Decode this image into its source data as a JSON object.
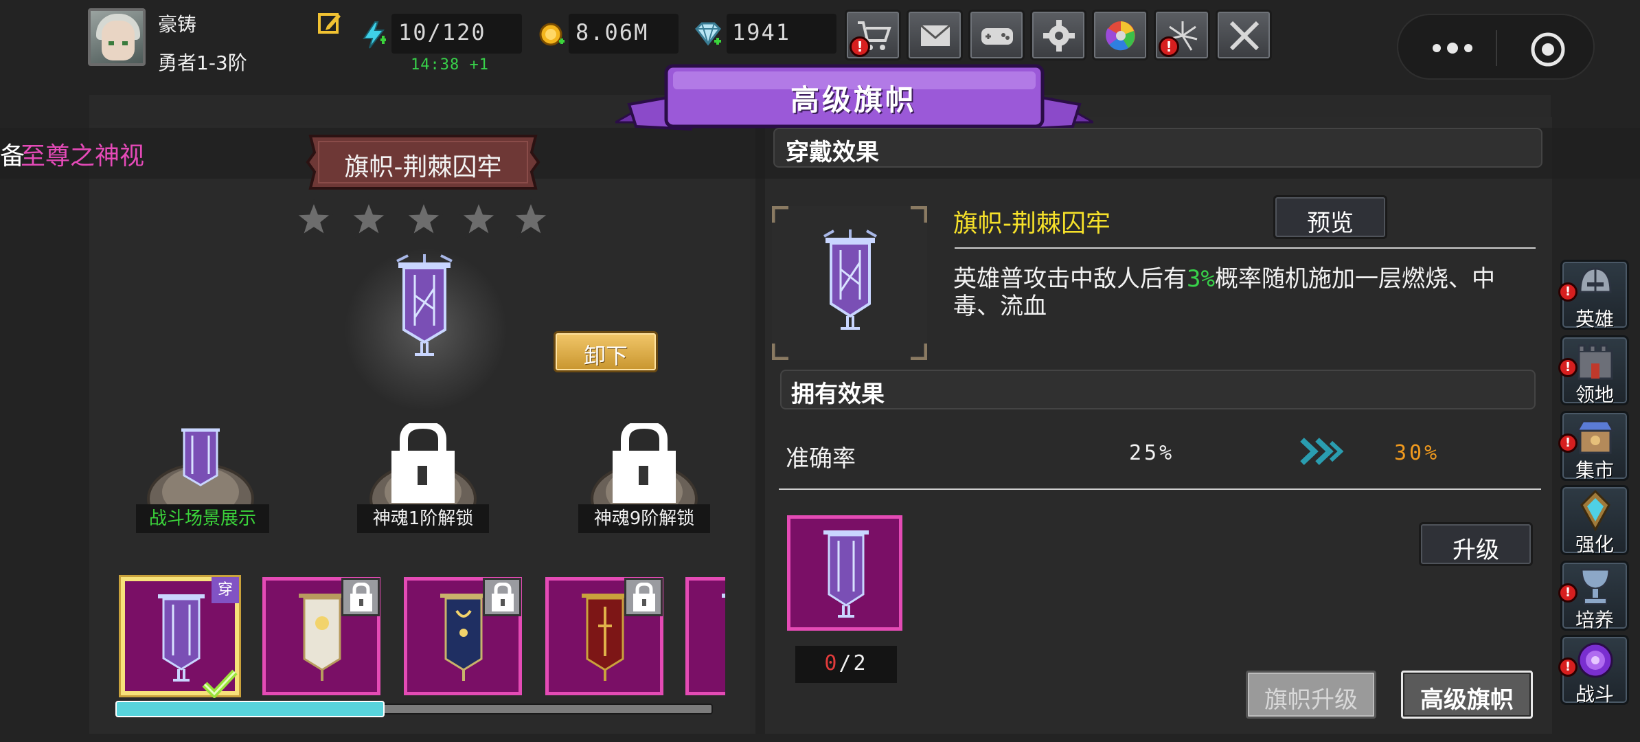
{
  "player": {
    "name": "豪铸",
    "rank": "勇者1-3阶",
    "avatar_icon": "hero-avatar-icon"
  },
  "resources": {
    "energy": "10/120",
    "energy_timer": "14:38 +1",
    "gold": "8.06M",
    "gems": "1941"
  },
  "top_buttons": [
    {
      "name": "shop-button",
      "icon": "cart-icon",
      "alert": true
    },
    {
      "name": "mail-button",
      "icon": "envelope-icon",
      "alert": false
    },
    {
      "name": "gamepad-button",
      "icon": "gamepad-icon",
      "alert": false
    },
    {
      "name": "settings-button",
      "icon": "gear-icon",
      "alert": false
    },
    {
      "name": "wheel-button",
      "icon": "color-wheel-icon",
      "alert": false
    },
    {
      "name": "fireworks-button",
      "icon": "fireworks-icon",
      "alert": true
    },
    {
      "name": "battle-button",
      "icon": "crossed-swords-icon",
      "alert": false
    }
  ],
  "alert_mark": "!",
  "marquee": {
    "prefix": "备",
    "item": "至尊之神视"
  },
  "page_title": "高级旗帜",
  "flag": {
    "name": "旗帜-荆棘囚牢",
    "stars": 5,
    "unequip_label": "卸下"
  },
  "pedestals": [
    {
      "label": "战斗场景展示",
      "locked": false,
      "color": "#3bd43b"
    },
    {
      "label": "神魂1阶解锁",
      "locked": true,
      "color": "#f2f2f2"
    },
    {
      "label": "神魂9阶解锁",
      "locked": true,
      "color": "#f2f2f2"
    }
  ],
  "cards": [
    {
      "name": "card-thorn-prison",
      "selected": true,
      "tag": "穿",
      "locked": false,
      "style": "thorn"
    },
    {
      "name": "card-white-banner",
      "selected": false,
      "locked": true,
      "style": "white"
    },
    {
      "name": "card-moon-banner",
      "selected": false,
      "locked": true,
      "style": "moon"
    },
    {
      "name": "card-red-banner",
      "selected": false,
      "locked": true,
      "style": "red"
    },
    {
      "name": "card-partial-banner",
      "selected": false,
      "locked": false,
      "style": "thorn"
    }
  ],
  "scroll": {
    "progress": 0.45
  },
  "wear_effect": {
    "header": "穿戴效果",
    "item_name": "旗帜-荆棘囚牢",
    "preview_label": "预览",
    "desc_prefix": "英雄普攻击中敌人后有",
    "desc_pct": "3%",
    "desc_suffix": "概率随机施加一层燃烧、中毒、流血"
  },
  "own_effect": {
    "header": "拥有效果",
    "stat_name": "准确率",
    "current": "25%",
    "next": "30%"
  },
  "material": {
    "have": "0",
    "need": "/2"
  },
  "upgrade_label": "升级",
  "tabs": {
    "flag_upgrade": "旗帜升级",
    "advanced_flag": "高级旗帜"
  },
  "side_nav": [
    {
      "name": "nav-hero",
      "label": "英雄",
      "icon": "helmet-icon",
      "alert": true
    },
    {
      "name": "nav-territory",
      "label": "领地",
      "icon": "castle-icon",
      "alert": true
    },
    {
      "name": "nav-market",
      "label": "集市",
      "icon": "market-icon",
      "alert": true
    },
    {
      "name": "nav-enhance",
      "label": "强化",
      "icon": "crystal-icon",
      "alert": false
    },
    {
      "name": "nav-cultivate",
      "label": "培养",
      "icon": "chalice-icon",
      "alert": true
    },
    {
      "name": "nav-battle",
      "label": "战斗",
      "icon": "portal-icon",
      "alert": true
    }
  ]
}
